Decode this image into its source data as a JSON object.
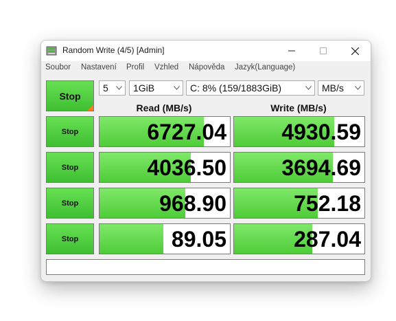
{
  "window": {
    "title": "Random Write (4/5) [Admin]",
    "accent": "#4fcc38"
  },
  "menu": [
    "Soubor",
    "Nastavení",
    "Profil",
    "Vzhled",
    "Nápověda",
    "Jazyk(Language)"
  ],
  "controls": {
    "main_stop": "Stop",
    "count": "5",
    "size": "1GiB",
    "drive": "C: 8% (159/1883GiB)",
    "unit": "MB/s"
  },
  "headers": {
    "read": "Read (MB/s)",
    "write": "Write (MB/s)"
  },
  "rows": [
    {
      "stop": "Stop",
      "read": "6727.04",
      "write": "4930.59",
      "read_level": 0.8,
      "write_level": 0.77
    },
    {
      "stop": "Stop",
      "read": "4036.50",
      "write": "3694.69",
      "read_level": 0.7,
      "write_level": 0.76
    },
    {
      "stop": "Stop",
      "read": "968.90",
      "write": "752.18",
      "read_level": 0.66,
      "write_level": 0.64
    },
    {
      "stop": "Stop",
      "read": "89.05",
      "write": "287.04",
      "read_level": 0.49,
      "write_level": 0.6
    }
  ],
  "comment": ""
}
